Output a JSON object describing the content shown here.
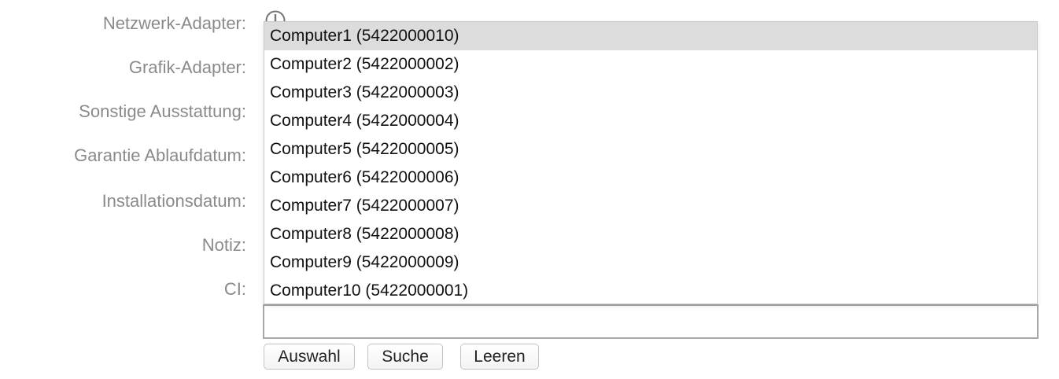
{
  "form": {
    "labels": {
      "network_adapter": "Netzwerk-Adapter:",
      "graphics_adapter": "Grafik-Adapter:",
      "other_equipment": "Sonstige Ausstattung:",
      "warranty_expiry": "Garantie Ablaufdatum:",
      "installation_date": "Installationsdatum:",
      "note": "Notiz:",
      "ci": "CI:"
    },
    "ci_input": {
      "value": "",
      "placeholder": ""
    }
  },
  "dropdown": {
    "selected_index": 0,
    "items": [
      "Computer1 (5422000010)",
      "Computer2 (5422000002)",
      "Computer3 (5422000003)",
      "Computer4 (5422000004)",
      "Computer5 (5422000005)",
      "Computer6 (5422000006)",
      "Computer7 (5422000007)",
      "Computer8 (5422000008)",
      "Computer9 (5422000009)",
      "Computer10 (5422000001)"
    ]
  },
  "buttons": {
    "select": "Auswahl",
    "search": "Suche",
    "clear": "Leeren"
  },
  "icons": {
    "info": "info-icon"
  }
}
